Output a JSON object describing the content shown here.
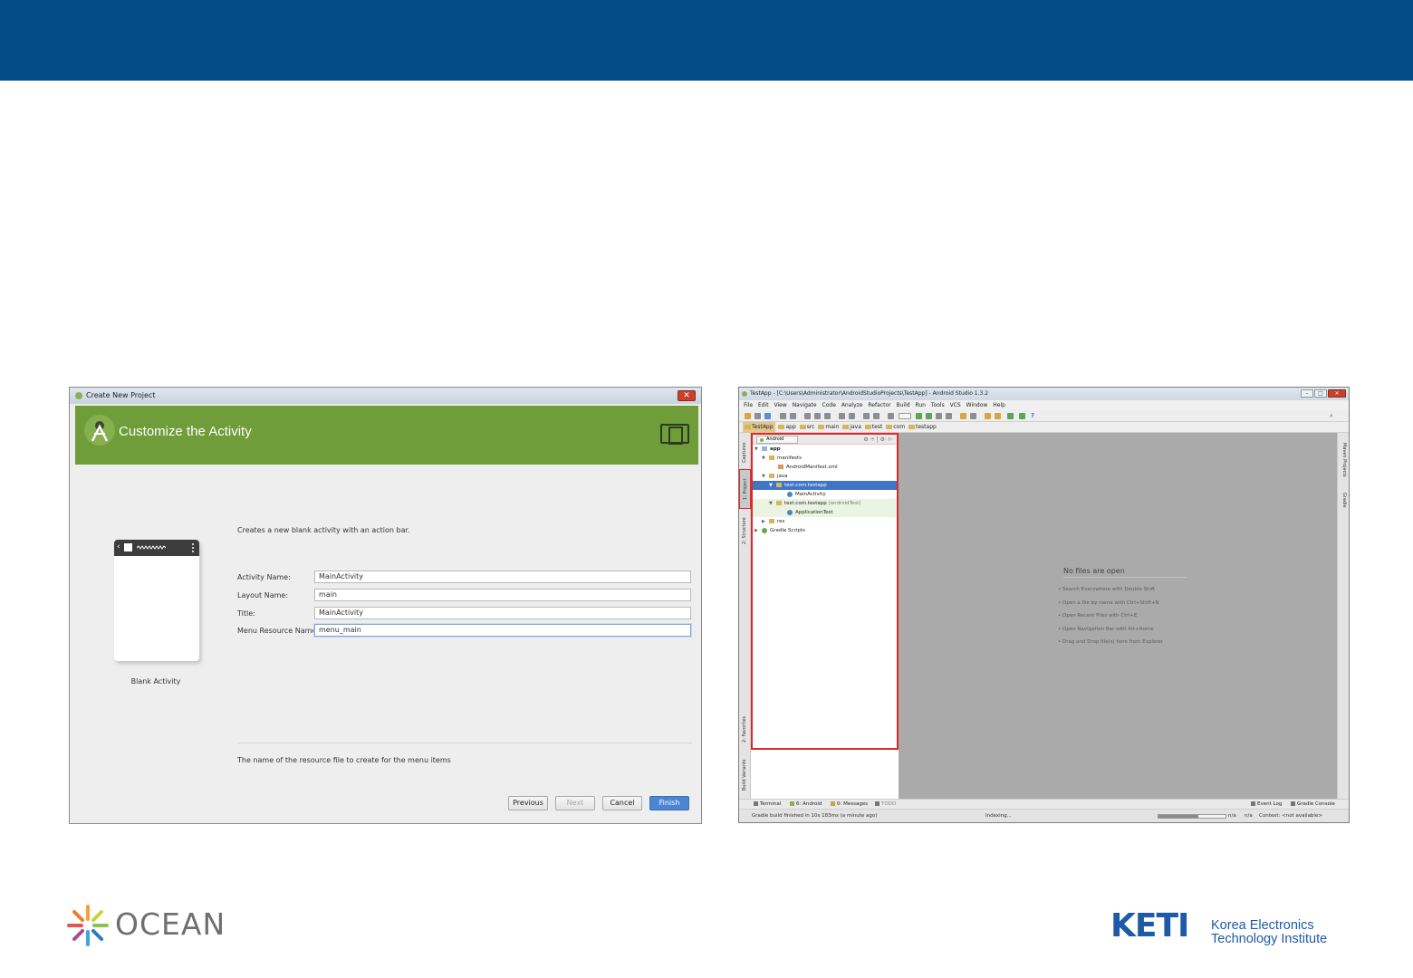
{
  "wizard": {
    "window_title": "Create New Project",
    "close_glyph": "✕",
    "header_title": "Customize the Activity",
    "template_label": "Blank Activity",
    "description": "Creates a new blank activity with an action bar.",
    "fields": [
      {
        "label": "Activity Name:",
        "value": "MainActivity"
      },
      {
        "label": "Layout Name:",
        "value": "main"
      },
      {
        "label": "Title:",
        "value": "MainActivity"
      },
      {
        "label": "Menu Resource Name:",
        "value": "menu_main"
      }
    ],
    "hint": "The name of the resource file to create for the menu items",
    "buttons": {
      "previous": "Previous",
      "next": "Next",
      "cancel": "Cancel",
      "finish": "Finish"
    },
    "header_color": "#6e9d3a"
  },
  "ide": {
    "window_title": "TestApp - [C:\\Users\\Administrator\\AndroidStudioProjects\\TestApp] - Android Studio 1.3.2",
    "menu": [
      "File",
      "Edit",
      "View",
      "Navigate",
      "Code",
      "Analyze",
      "Refactor",
      "Build",
      "Run",
      "Tools",
      "VCS",
      "Window",
      "Help"
    ],
    "breadcrumbs": [
      "TestApp",
      "app",
      "src",
      "main",
      "java",
      "test",
      "com",
      "testapp"
    ],
    "project_view": "Android",
    "tree": [
      {
        "label": "app",
        "sub": ""
      },
      {
        "label": "manifests",
        "sub": ""
      },
      {
        "label": "AndroidManifest.xml",
        "sub": ""
      },
      {
        "label": "java",
        "sub": ""
      },
      {
        "label": "test.com.testapp",
        "sub": ""
      },
      {
        "label": "MainActivity",
        "sub": ""
      },
      {
        "label": "test.com.testapp",
        "sub": "(androidTest)"
      },
      {
        "label": "ApplicationTest",
        "sub": ""
      },
      {
        "label": "res",
        "sub": ""
      },
      {
        "label": "Gradle Scripts",
        "sub": ""
      }
    ],
    "left_tabs": {
      "captures": "Captures",
      "project": "1: Project",
      "structure": "2: Structure",
      "favorites": "2: Favorites",
      "build_variants": "Build Variants"
    },
    "right_tabs": {
      "maven": "Maven Projects",
      "gradle": "Gradle"
    },
    "editor_empty_title": "No files are open",
    "editor_tips": [
      "• Search Everywhere with Double Shift",
      "• Open a file by name with Ctrl+Shift+N",
      "• Open Recent Files with Ctrl+E",
      "• Open Navigation Bar with Alt+Home",
      "• Drag and Drop file(s) here from Explorer"
    ],
    "bottom_tabs": {
      "terminal": "Terminal",
      "android": "6: Android",
      "messages": "0: Messages",
      "todo": "TODO",
      "event_log": "Event Log",
      "gradle_console": "Gradle Console"
    },
    "status": {
      "message": "Gradle build finished in 10s 183ms (a minute ago)",
      "indexing": "Indexing...",
      "pos1": "n/a",
      "pos2": "n/a",
      "context": "Context: <not available>"
    },
    "indexing_progress": 0.6,
    "selection_color": "#3f75c7",
    "highlight_color": "#e02a2a"
  },
  "footer": {
    "ocean_text": "OCEAN",
    "keti_mark": "KETI",
    "keti_name_line1": "Korea Electronics",
    "keti_name_line2": "Technology Institute"
  },
  "banner_color": "#034a87"
}
